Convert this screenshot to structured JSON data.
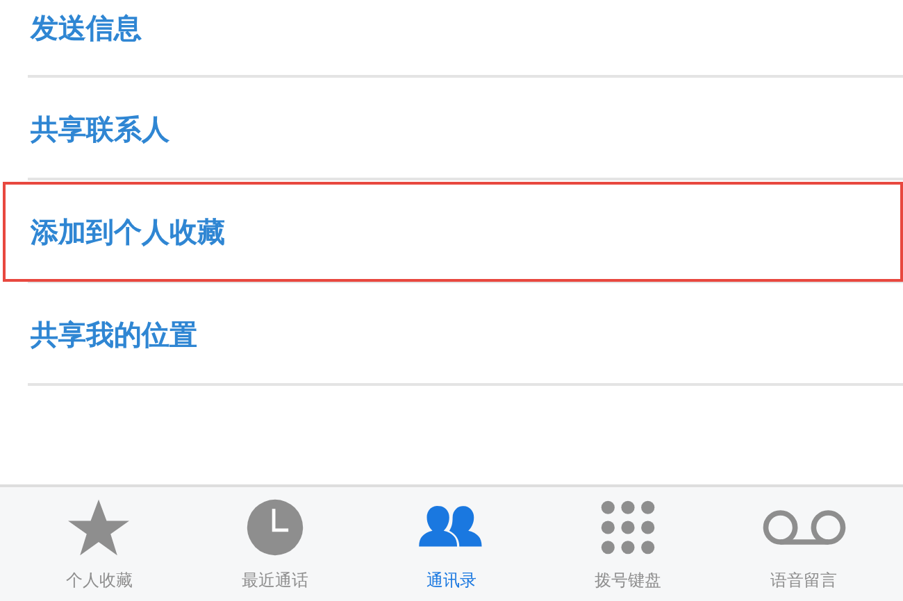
{
  "actions": [
    {
      "label": "发送信息",
      "highlighted": false
    },
    {
      "label": "共享联系人",
      "highlighted": false
    },
    {
      "label": "添加到个人收藏",
      "highlighted": true
    },
    {
      "label": "共享我的位置",
      "highlighted": false
    }
  ],
  "tab_bar": [
    {
      "kind": "star",
      "label": "个人收藏",
      "selected": false
    },
    {
      "kind": "clock",
      "label": "最近通话",
      "selected": false
    },
    {
      "kind": "contacts",
      "label": "通讯录",
      "selected": true
    },
    {
      "kind": "keypad",
      "label": "拨号键盘",
      "selected": false
    },
    {
      "kind": "voicemail",
      "label": "语音留言",
      "selected": false
    }
  ]
}
